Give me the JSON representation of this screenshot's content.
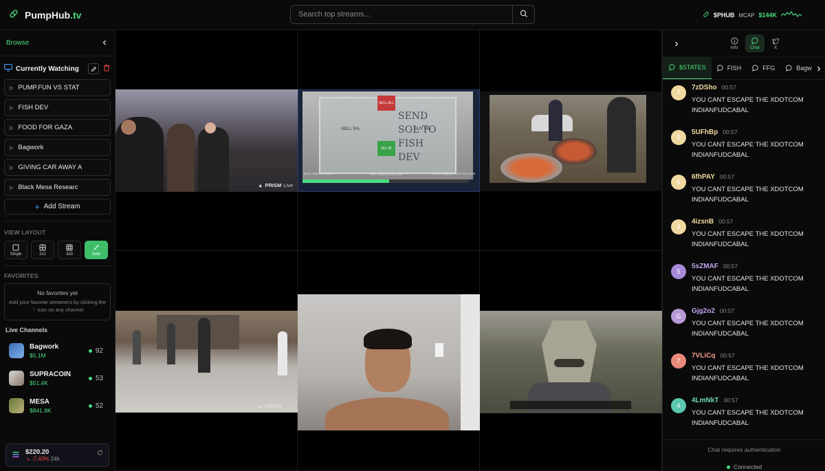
{
  "header": {
    "logo_main": "PumpHub",
    "logo_suffix": ".tv",
    "search_placeholder": "Search top streams...",
    "token_symbol": "$PHUB",
    "mcap_label": "MCAP",
    "mcap_value": "$144K"
  },
  "sidebar": {
    "browse_label": "Browse",
    "currently_watching_label": "Currently Watching",
    "streams": [
      {
        "label": "PUMP.FUN VS STAT"
      },
      {
        "label": "FISH DEV"
      },
      {
        "label": "FOOD FOR GAZA"
      },
      {
        "label": "Bagwork"
      },
      {
        "label": "GIVING CAR AWAY A"
      },
      {
        "label": "Black Mesa Researc"
      }
    ],
    "add_stream_label": "Add Stream",
    "view_layout_label": "VIEW LAYOUT",
    "layouts": [
      {
        "label": "Single",
        "icon": "square-icon"
      },
      {
        "label": "2x2",
        "icon": "grid-2x2-icon"
      },
      {
        "label": "3x3",
        "icon": "grid-3x3-icon"
      },
      {
        "label": "Auto",
        "icon": "magic-wand-icon",
        "active": true
      }
    ],
    "favorites_label": "FAVORITES",
    "favorites_empty_title": "No favorites yet",
    "favorites_empty_desc": "Add your favorite streamers by clicking the ♡ icon on any channel",
    "live_channels_label": "Live Channels",
    "channels": [
      {
        "name": "Bagwork",
        "mcap": "$5.1M",
        "viewers": "92"
      },
      {
        "name": "SUPRACOIN",
        "mcap": "$51.4K",
        "viewers": "53"
      },
      {
        "name": "MESA",
        "mcap": "$841.8K",
        "viewers": "52"
      }
    ],
    "price": {
      "value": "$220.20",
      "change": "-7.43%",
      "period": "24h"
    }
  },
  "grid": {
    "overlays": {
      "prism_label": "PRISM",
      "prism_live": "Live",
      "fish_sell": "SELL 5%",
      "fish_buy": "BUY 5%",
      "fish_sell_all": "SELL ALL",
      "fish_all_in": "ALL IN",
      "fish_note": "SEND SOL TO FISH DEV",
      "fish_sol_balance": "$SOL Balance: 0.597",
      "fish_fish_balance": "$FISH Balance: 10473213.338",
      "fish_countdown": "NEXT TRADE COUNTDOWN"
    }
  },
  "chat": {
    "top_tabs": [
      {
        "label": "Info",
        "icon": "info-icon"
      },
      {
        "label": "Chat",
        "icon": "chat-bubble-icon",
        "active": true
      },
      {
        "label": "X",
        "icon": "bird-icon"
      }
    ],
    "rooms": [
      {
        "label": "$STATES",
        "active": true
      },
      {
        "label": "FISH"
      },
      {
        "label": "FFG"
      },
      {
        "label": "Bagw"
      }
    ],
    "messages": [
      {
        "initial": "7",
        "user": "7zDSho",
        "time": "00:57",
        "text": "YOU CANT ESCAPE THE XDOTCOM INDIANFUDCABAL",
        "color": "#f0d9a0",
        "user_color": "#f0d9a0"
      },
      {
        "initial": "5",
        "user": "5UFhBp",
        "time": "00:57",
        "text": "YOU CANT ESCAPE THE XDOTCOM INDIANFUDCABAL",
        "color": "#f0d9a0",
        "user_color": "#f0d9a0"
      },
      {
        "initial": "6",
        "user": "6fhPAY",
        "time": "00:57",
        "text": "YOU CANT ESCAPE THE XDOTCOM INDIANFUDCABAL",
        "color": "#f0d9a0",
        "user_color": "#f0d9a0"
      },
      {
        "initial": "4",
        "user": "4izsnB",
        "time": "00:57",
        "text": "YOU CANT ESCAPE THE XDOTCOM INDIANFUDCABAL",
        "color": "#f0d9a0",
        "user_color": "#f0d9a0"
      },
      {
        "initial": "5",
        "user": "5sZMAF",
        "time": "00:57",
        "text": "YOU CANT ESCAPE THE XDOTCOM INDIANFUDCABAL",
        "color": "#a78bd8",
        "user_color": "#c0a6f0"
      },
      {
        "initial": "G",
        "user": "Gjg2o2",
        "time": "00:57",
        "text": "YOU CANT ESCAPE THE XDOTCOM INDIANFUDCABAL",
        "color": "#b79ad6",
        "user_color": "#c0a6f0"
      },
      {
        "initial": "7",
        "user": "7VLiCq",
        "time": "00:57",
        "text": "YOU CANT ESCAPE THE XDOTCOM INDIANFUDCABAL",
        "color": "#e88a7a",
        "user_color": "#f09a88"
      },
      {
        "initial": "4",
        "user": "4LmNkT",
        "time": "00:57",
        "text": "YOU CANT ESCAPE THE XDOTCOM INDIANFUDCABAL",
        "color": "#5cc8b0",
        "user_color": "#6fd8c0"
      }
    ],
    "auth_notice": "Chat requires authentication",
    "status": "Connected"
  }
}
